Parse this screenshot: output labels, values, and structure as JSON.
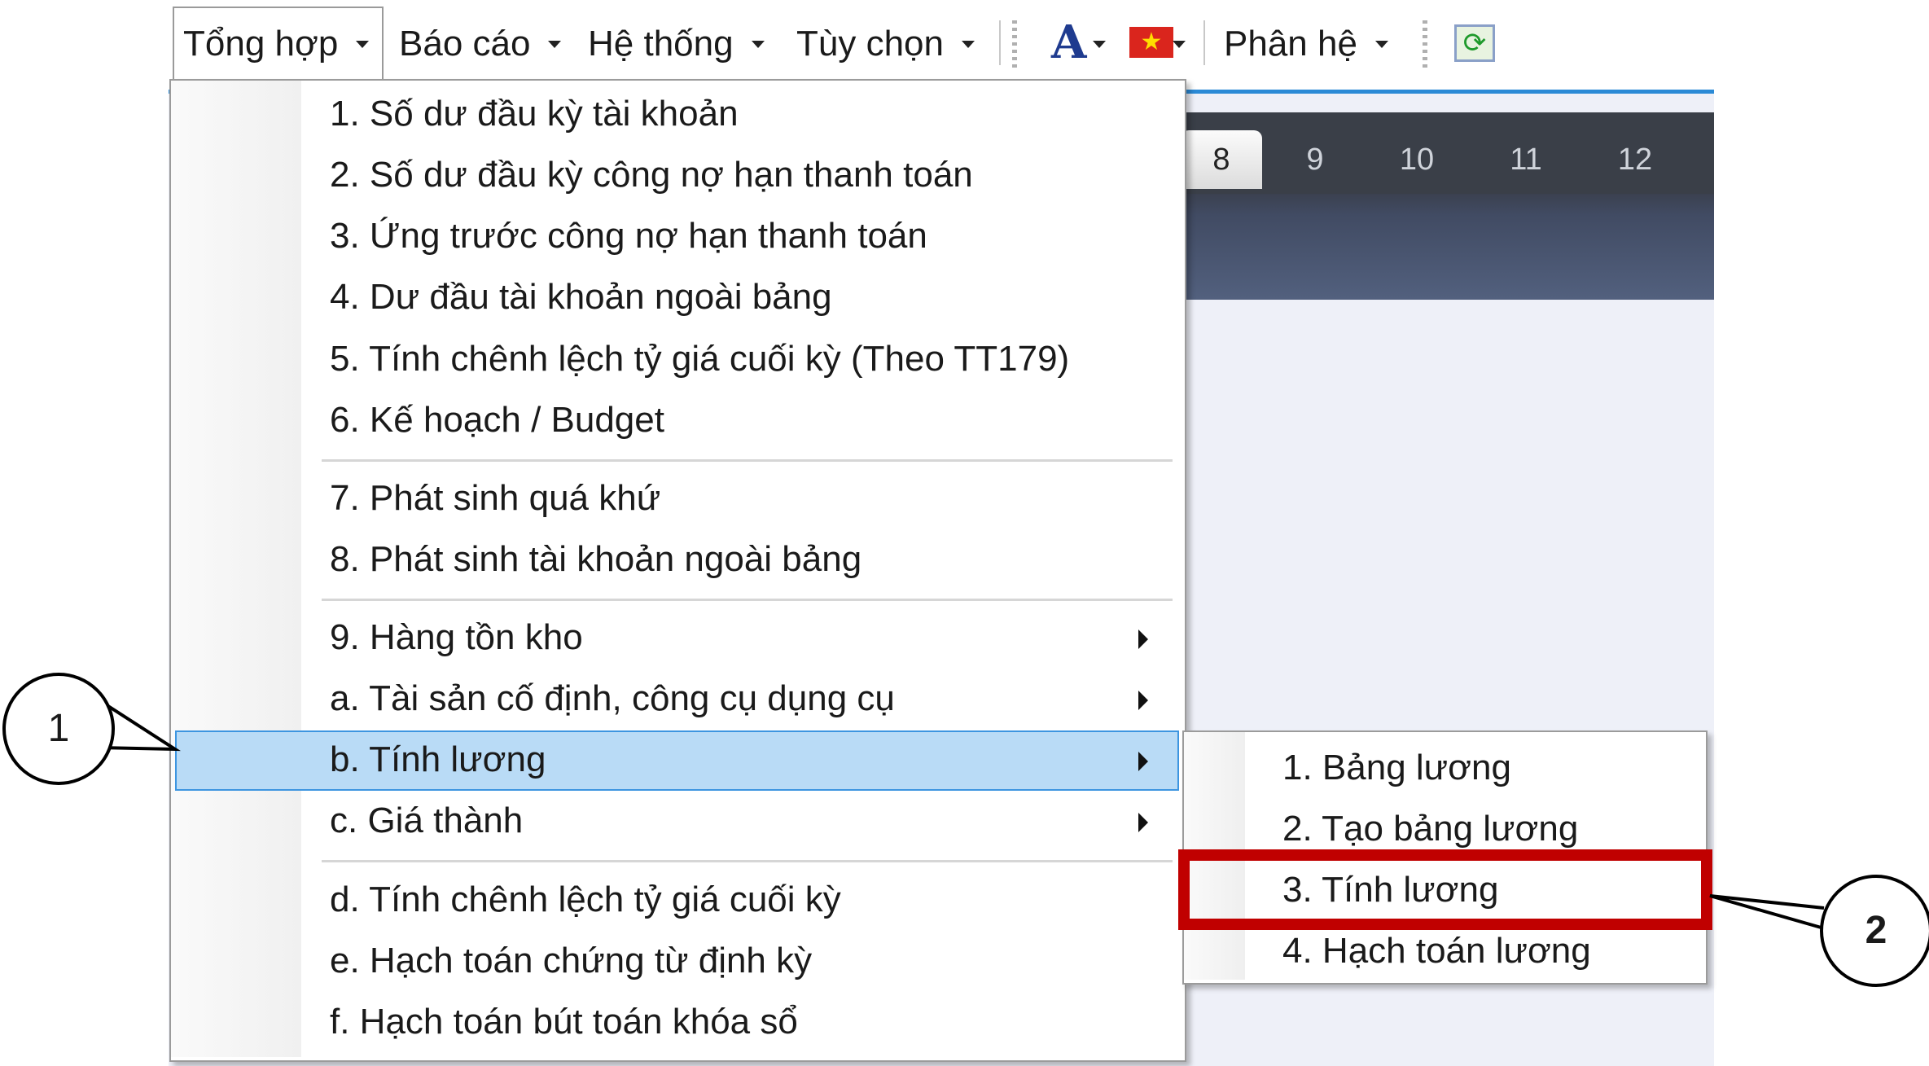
{
  "menubar": {
    "items": [
      {
        "label": "Tổng hợp"
      },
      {
        "label": "Báo cáo"
      },
      {
        "label": "Hệ thống"
      },
      {
        "label": "Tùy chọn"
      },
      {
        "label": "Phân hệ"
      }
    ],
    "font_icon_glyph": "A",
    "flag_icon_glyph": "★",
    "refresh_icon_glyph": "⟳"
  },
  "tabs": [
    "8",
    "9",
    "10",
    "11",
    "12"
  ],
  "dropdown": {
    "items": [
      "1. Số dư đầu kỳ tài khoản",
      "2. Số dư đầu kỳ công nợ hạn thanh toán",
      "3. Ứng trước công nợ hạn thanh toán",
      "4. Dư đầu tài khoản ngoài bảng",
      "5. Tính chênh lệch tỷ giá cuối kỳ (Theo TT179)",
      "6. Kế hoạch / Budget",
      "7. Phát sinh quá khứ",
      "8. Phát sinh tài khoản ngoài bảng",
      "9. Hàng tồn kho",
      "a. Tài sản cố định, công cụ dụng cụ",
      "b. Tính lương",
      "c. Giá thành",
      "d. Tính chênh lệch tỷ giá cuối kỳ",
      "e. Hạch toán chứng từ định kỳ",
      "f. Hạch toán bút toán khóa sổ"
    ]
  },
  "submenu": {
    "items": [
      "1. Bảng lương",
      "2. Tạo bảng lương",
      "3. Tính lương",
      "4. Hạch toán lương"
    ]
  },
  "callouts": [
    "1",
    "2"
  ],
  "colors": {
    "highlight": "#b9dbf6",
    "highlight_border": "#3d95e0",
    "callout_box": "#c00000",
    "accent": "#2b8ad6"
  }
}
